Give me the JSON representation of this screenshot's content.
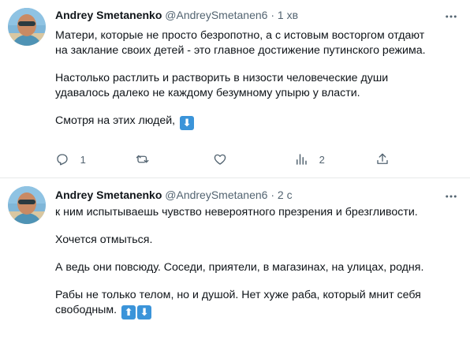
{
  "tweets": [
    {
      "author_name": "Andrey Smetanenko",
      "handle": "@AndreySmetanen6",
      "separator": "·",
      "time": "1 хв",
      "paragraphs": [
        "Матери, которые не просто безропотно, а с истовым восторгом отдают\nна заклание своих детей - это главное достижение путинского режима.",
        "Настолько растлить и растворить в низости человеческие души\nудавалось далеко не каждому безумному упырю у власти.",
        "Смотря на этих людей,"
      ],
      "trailing_emoji": "⬇",
      "actions": {
        "reply_count": "1",
        "retweet_count": "",
        "like_count": "",
        "views_count": "2",
        "share_count": ""
      }
    },
    {
      "author_name": "Andrey Smetanenko",
      "handle": "@AndreySmetanen6",
      "separator": "·",
      "time": "2 с",
      "paragraphs": [
        "к ним испытываешь чувство невероятного презрения и брезгливости.",
        "Хочется отмыться.",
        "А ведь они повсюду. Соседи, приятели, в магазинах, на улицах, родня.",
        "Рабы не только телом, но и душой. Нет хуже раба, который мнит себя\nсвободным."
      ],
      "trailing_emojis": [
        "⬆",
        "⬇"
      ]
    }
  ],
  "icons": {
    "more": "more-icon",
    "reply": "reply-icon",
    "retweet": "retweet-icon",
    "like": "like-icon",
    "views": "views-icon",
    "share": "share-icon"
  },
  "colors": {
    "text": "#0f1419",
    "secondary": "#536471",
    "divider": "#e7e9ea",
    "emoji_blue": "#3b94d9"
  }
}
